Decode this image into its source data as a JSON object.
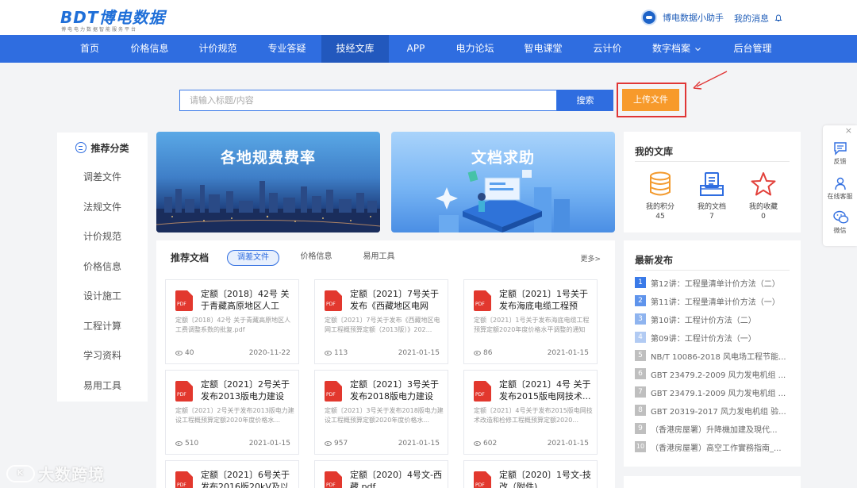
{
  "header": {
    "logo_text": "BDT博电数据",
    "logo_sub": "博电电力数据智能服务平台",
    "assistant_label": "博电数据小助手",
    "messages_label": "我的消息"
  },
  "nav": [
    "首页",
    "价格信息",
    "计价规范",
    "专业答疑",
    "技经文库",
    "APP",
    "电力论坛",
    "智电课堂",
    "云计价",
    "数字档案",
    "后台管理"
  ],
  "nav_active": "技经文库",
  "search": {
    "placeholder": "请输入标题/内容",
    "button": "搜索",
    "upload": "上传文件"
  },
  "sidebar": {
    "title": "推荐分类",
    "items": [
      "调差文件",
      "法规文件",
      "计价规范",
      "价格信息",
      "设计施工",
      "工程计算",
      "学习资料",
      "易用工具"
    ]
  },
  "banners": [
    {
      "title": "各地规费费率"
    },
    {
      "title": "文档求助"
    }
  ],
  "recommended": {
    "title": "推荐文档",
    "tabs": [
      "调差文件",
      "价格信息",
      "易用工具"
    ],
    "more": "更多>",
    "docs": [
      {
        "title": "定额〔2018〕42号 关于青藏高原地区人工费...",
        "desc": "定额〔2018〕42号 关于青藏高原地区人工费调整系数的批复.pdf",
        "views": "40",
        "date": "2020-11-22"
      },
      {
        "title": "定额〔2021〕7号关于发布《西藏地区电网工...",
        "desc": "定额〔2021〕7号关于发布《西藏地区电网工程概预算定额（2013版）》202...",
        "views": "113",
        "date": "2021-01-15"
      },
      {
        "title": "定额〔2021〕1号关于发布海底电缆工程预算...",
        "desc": "定额〔2021〕1号关于发布海底电缆工程预算定额2020年度价格水平调整的通知",
        "views": "86",
        "date": "2021-01-15"
      },
      {
        "title": "定额〔2021〕2号关于发布2013版电力建设工...",
        "desc": "定额〔2021〕2号关于发布2013版电力建设工程概预算定额2020年度价格水...",
        "views": "510",
        "date": "2021-01-15"
      },
      {
        "title": "定额〔2021〕3号关于发布2018版电力建设工...",
        "desc": "定额〔2021〕3号关于发布2018版电力建设工程概预算定额2020年度价格水...",
        "views": "957",
        "date": "2021-01-15"
      },
      {
        "title": "定额〔2021〕4号 关于发布2015版电网技术...",
        "desc": "定额〔2021〕4号关于发布2015版电网技术改造和检修工程概预算定额2020...",
        "views": "602",
        "date": "2021-01-15"
      },
      {
        "title": "定额〔2021〕6号关于发布2016版20kV及以",
        "desc": "",
        "views": "",
        "date": ""
      },
      {
        "title": "定额〔2020〕4号文-西藏.pdf",
        "desc": "",
        "views": "",
        "date": ""
      },
      {
        "title": "定额〔2020〕1号文-技改（附件)",
        "desc": "",
        "views": "",
        "date": ""
      }
    ]
  },
  "library": {
    "title": "我的文库",
    "items": [
      {
        "label": "我的积分",
        "count": "45"
      },
      {
        "label": "我的文档",
        "count": "7"
      },
      {
        "label": "我的收藏",
        "count": "0"
      }
    ]
  },
  "latest": {
    "title": "最新发布",
    "items": [
      {
        "n": "1",
        "text": "第12讲：工程量清单计价方法（二）"
      },
      {
        "n": "2",
        "text": "第11讲：工程量清单计价方法（一）"
      },
      {
        "n": "3",
        "text": "第10讲：工程计价方法（二）"
      },
      {
        "n": "4",
        "text": "第09讲：工程计价方法（一）"
      },
      {
        "n": "5",
        "text": "NB/T 10086-2018 风电场工程节能..."
      },
      {
        "n": "6",
        "text": "GBT 23479.2-2009 风力发电机组 ..."
      },
      {
        "n": "7",
        "text": "GBT 23479.1-2009 风力发电机组 ..."
      },
      {
        "n": "8",
        "text": "GBT 20319-2017 风力发电机组 验..."
      },
      {
        "n": "9",
        "text": "（香港房屋署）升降機加建及現代..."
      },
      {
        "n": "10",
        "text": "（香港房屋署）高空工作實務指南_..."
      }
    ],
    "colors": {
      "top": "#3a7ae8",
      "mid": "#8fb4ef",
      "rest": "#bfbfbf"
    }
  },
  "floatbar": {
    "items": [
      "反馈",
      "在线客服",
      "微信"
    ]
  },
  "watermark": "大数跨境"
}
